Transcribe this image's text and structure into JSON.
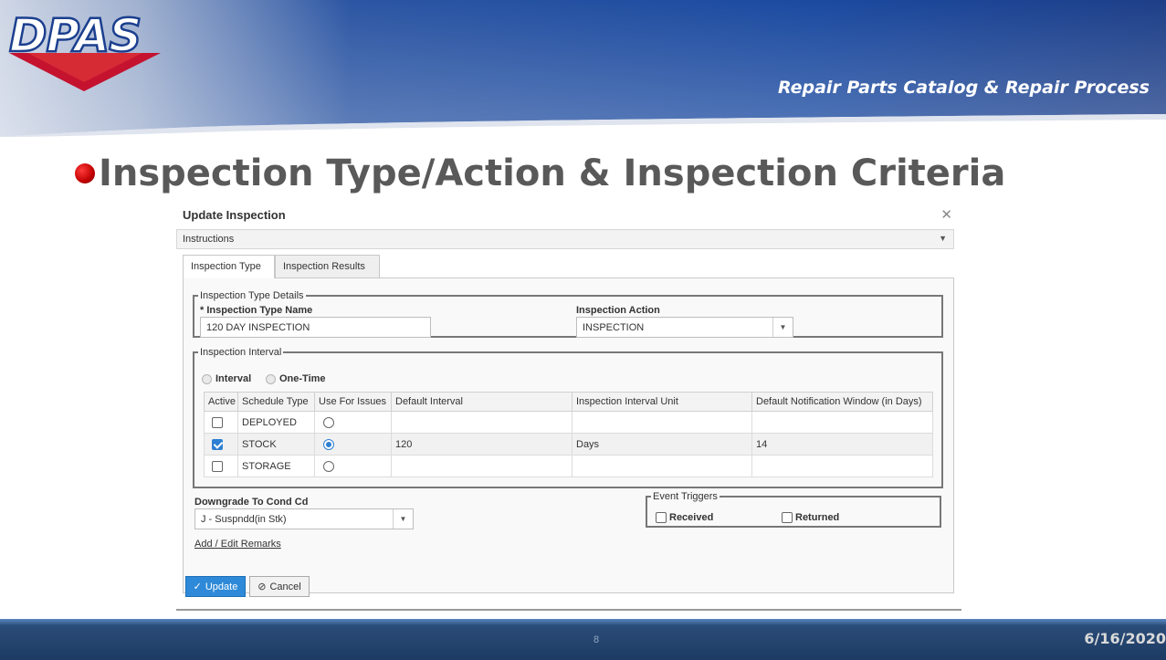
{
  "slide": {
    "subtitle": "Repair Parts Catalog & Repair Process",
    "title": "Inspection Type/Action & Inspection Criteria",
    "page_number": "8",
    "date": "6/16/2020",
    "logo_text": "DPAS",
    "colors": {
      "header_blue": "#1f4d9c",
      "footer_blue": "#1d3b63",
      "bullet_red": "#c00000",
      "accent_blue": "#2e8ad8"
    }
  },
  "dialog": {
    "title": "Update Inspection",
    "close_icon": "close-icon",
    "instructions_label": "Instructions",
    "tabs": [
      {
        "label": "Inspection Type",
        "active": true
      },
      {
        "label": "Inspection Results",
        "active": false
      }
    ],
    "type_details": {
      "legend": "Inspection Type Details",
      "name_label": "* Inspection Type Name",
      "name_value": "120 DAY INSPECTION",
      "action_label": "Inspection Action",
      "action_value": "INSPECTION"
    },
    "interval": {
      "legend": "Inspection Interval",
      "option_interval": "Interval",
      "option_onetime": "One-Time",
      "columns": [
        "Active",
        "Schedule Type",
        "Use For Issues",
        "Default Interval",
        "Inspection Interval Unit",
        "Default Notification Window (in Days)"
      ],
      "rows": [
        {
          "active": false,
          "schedule_type": "DEPLOYED",
          "use_for_issues": false,
          "default_interval": "",
          "unit": "",
          "notification_window": ""
        },
        {
          "active": true,
          "schedule_type": "STOCK",
          "use_for_issues": true,
          "default_interval": "120",
          "unit": "Days",
          "notification_window": "14"
        },
        {
          "active": false,
          "schedule_type": "STORAGE",
          "use_for_issues": false,
          "default_interval": "",
          "unit": "",
          "notification_window": ""
        }
      ]
    },
    "downgrade_label": "Downgrade To Cond Cd",
    "downgrade_value": "J - Suspndd(in Stk)",
    "event_triggers": {
      "legend": "Event Triggers",
      "received": "Received",
      "returned": "Returned"
    },
    "remarks_link": "Add / Edit Remarks",
    "update_button": "Update",
    "cancel_button": "Cancel"
  }
}
